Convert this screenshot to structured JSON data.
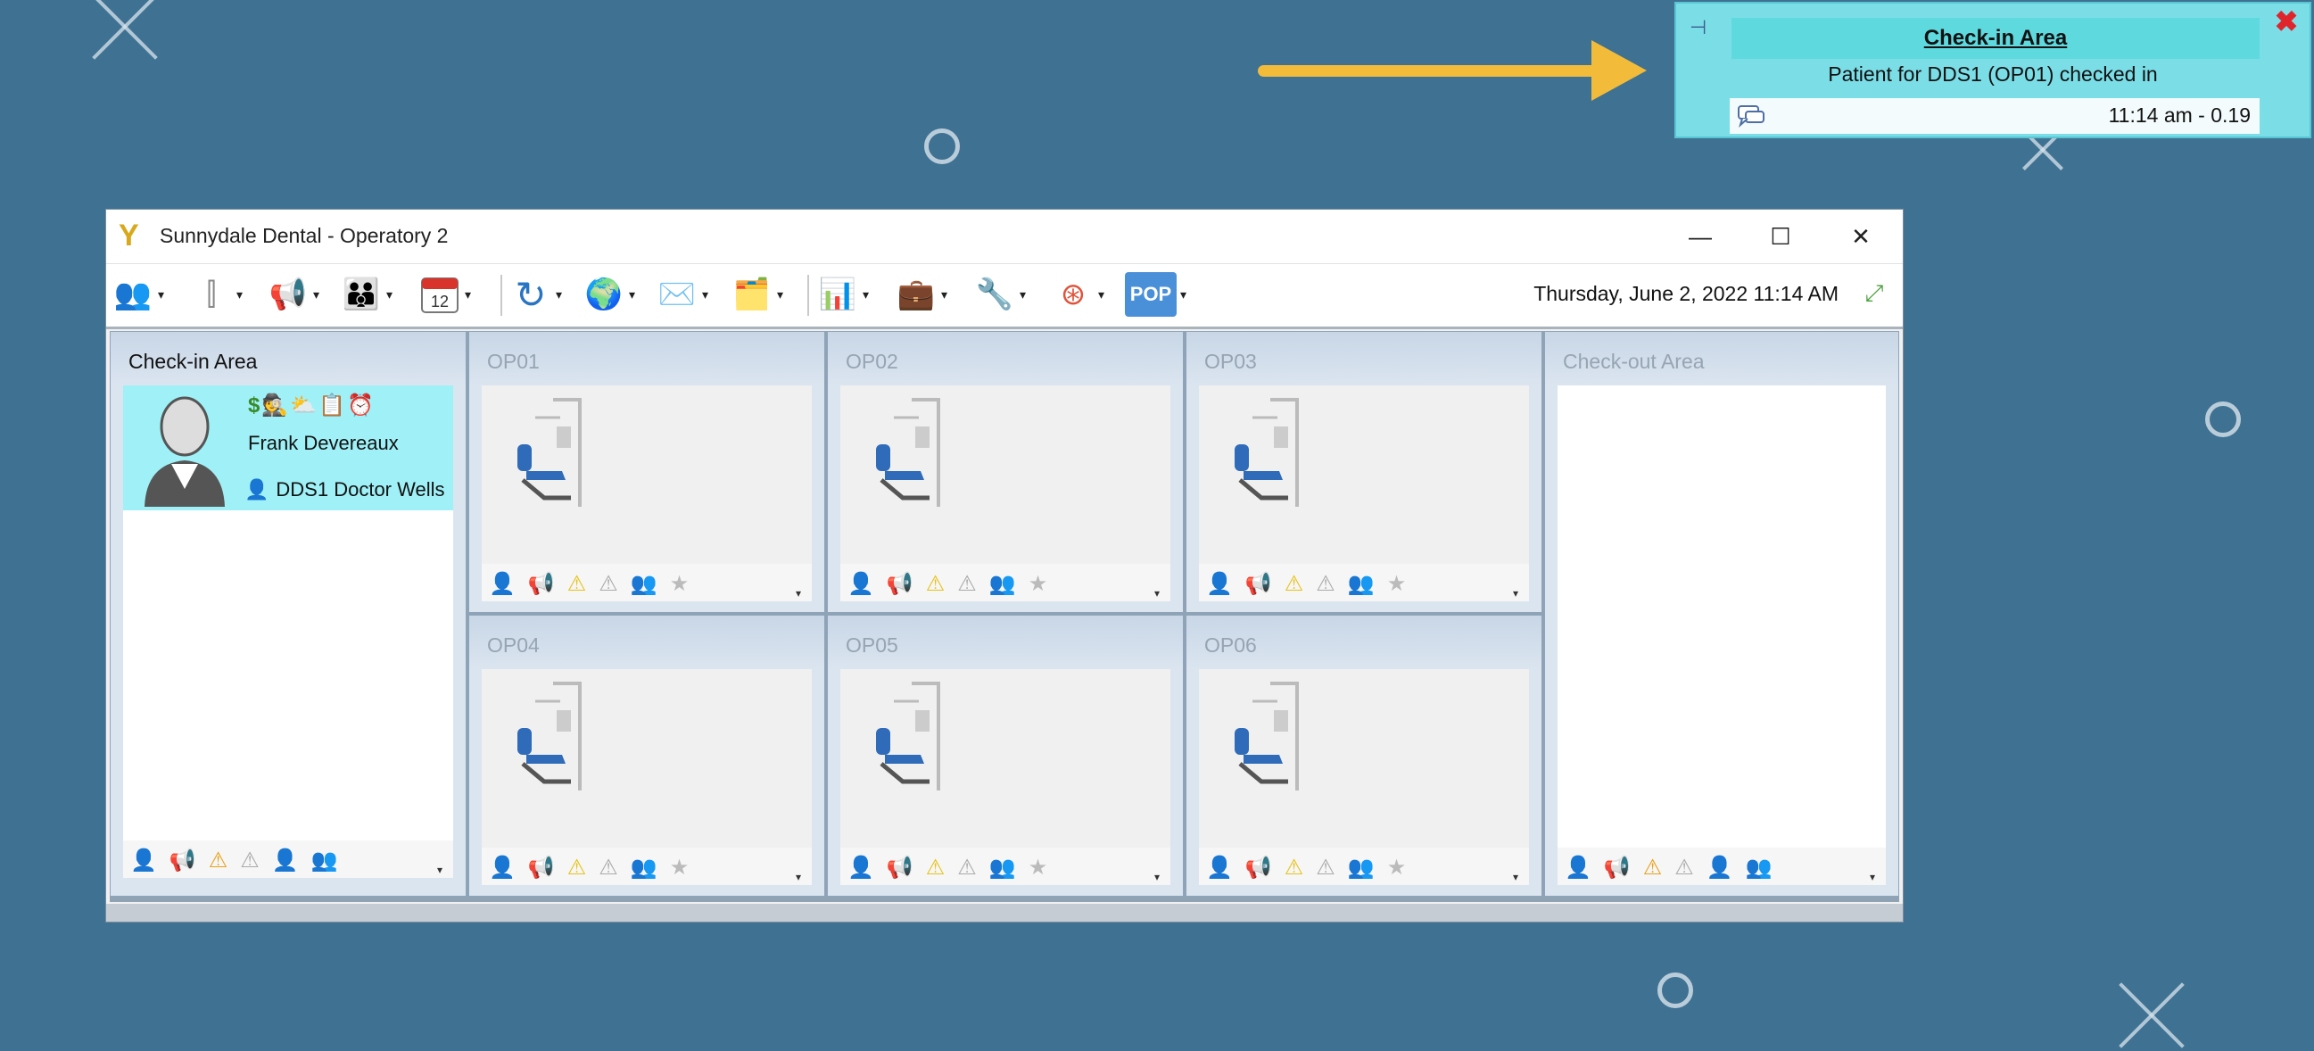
{
  "notification": {
    "title": "Check-in Area",
    "message": "Patient for DDS1 (OP01) checked in",
    "time": "11:14 am - 0.19",
    "pin_icon": "pin-icon",
    "close_icon": "close-icon",
    "comment_icon": "speech-bubble-icon"
  },
  "window": {
    "title": "Sunnydale Dental - Operatory 2",
    "minimize": "—",
    "maximize": "☐",
    "close": "✕",
    "datetime": "Thursday, June 2, 2022 11:14 AM"
  },
  "toolbar": {
    "calendar_day": "12",
    "pop_label": "POP",
    "items": [
      "patients-icon",
      "radio-tower-icon",
      "megaphone-icon",
      "family-icon",
      "calendar-icon",
      "refresh-icon",
      "globe-icon",
      "mail-icon",
      "folder-icon",
      "chart-icon",
      "briefcase-icon",
      "wrench-icon",
      "lifebuoy-icon",
      "pop-icon"
    ]
  },
  "areas": {
    "checkin": {
      "label": "Check-in Area"
    },
    "checkout": {
      "label": "Check-out Area"
    },
    "ops": [
      "OP01",
      "OP02",
      "OP03",
      "OP04",
      "OP05",
      "OP06"
    ]
  },
  "patient": {
    "name": "Frank Devereaux",
    "provider": "DDS1 Doctor Wells",
    "status_icons": [
      "dollar-icon",
      "doctor-icon",
      "weather-icon",
      "chart-icon",
      "alarm-icon"
    ]
  },
  "colors": {
    "background": "#3f7192",
    "notification": "#7bdde6",
    "checkin_card": "#9ff1f7",
    "accent_arrow": "#f2bb3a"
  }
}
